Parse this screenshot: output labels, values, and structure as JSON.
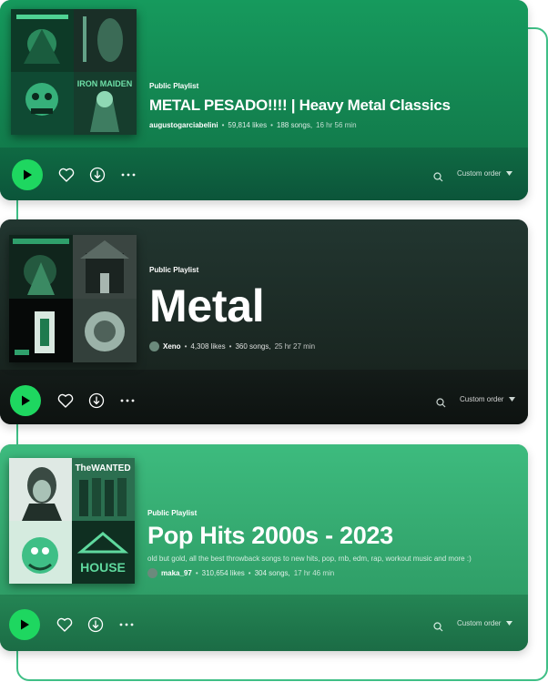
{
  "colors": {
    "accent": "#1ed760",
    "connector": "#3fbf86",
    "card1_top": "#138c55",
    "card1_bottom": "#0f5f3d",
    "card2_top": "#1c2a25",
    "card2_bottom": "#0f1412",
    "card3_top": "#38ad74",
    "card3_bottom": "#1d7a4f"
  },
  "playlists": [
    {
      "type_label": "Public Playlist",
      "title": "METAL PESADO!!!! | Heavy Metal Classics",
      "description": "",
      "owner": "augustogarciabelini",
      "likes": "59,814 likes",
      "songs": "188 songs,",
      "duration": "16 hr 56 min",
      "sort_label": "Custom order"
    },
    {
      "type_label": "Public Playlist",
      "title": "Metal",
      "description": "",
      "owner": "Xeno",
      "likes": "4,308 likes",
      "songs": "360 songs,",
      "duration": "25 hr 27 min",
      "sort_label": "Custom order"
    },
    {
      "type_label": "Public Playlist",
      "title": "Pop Hits 2000s - 2023",
      "description": "old but gold, all the best throwback songs to new hits, pop, rnb, edm, rap, workout music and more :)",
      "owner": "maka_97",
      "likes": "310,654 likes",
      "songs": "304 songs,",
      "duration": "17 hr 46 min",
      "sort_label": "Custom order"
    }
  ],
  "cover_texts": {
    "iron_maiden": "IRON MAIDEN",
    "the_wanted": "TheWANTED",
    "house": "HOUSE"
  },
  "separators": {
    "dot": "•"
  },
  "icons": {
    "play": "play-icon",
    "like": "heart-icon",
    "download": "download-icon",
    "more": "more-icon",
    "search": "search-icon",
    "sort": "caret-down-icon"
  }
}
